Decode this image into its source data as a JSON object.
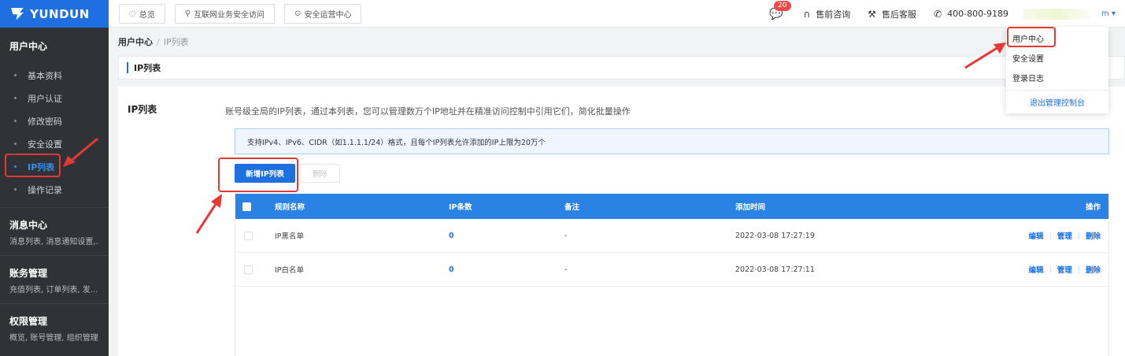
{
  "brand": {
    "name": "YUNDUN"
  },
  "topbar": {
    "buttons": [
      {
        "label": "总览",
        "icon": "dashboard-icon"
      },
      {
        "label": "互联网业务安全访问",
        "icon": "link-icon"
      },
      {
        "label": "安全运营中心",
        "icon": "shield-icon"
      }
    ],
    "message_count": "20",
    "presales": "售前咨询",
    "aftersales": "售后客服",
    "phone": "400-800-9189",
    "user_caret": "m ▾"
  },
  "sidebar": {
    "section_title": "用户中心",
    "items": [
      {
        "label": "基本资料"
      },
      {
        "label": "用户认证"
      },
      {
        "label": "修改密码"
      },
      {
        "label": "安全设置"
      },
      {
        "label": "IP列表"
      },
      {
        "label": "操作记录"
      }
    ],
    "active_index": 4,
    "groups": [
      {
        "title": "消息中心",
        "desc": "消息列表, 消息通知设置,..."
      },
      {
        "title": "账务管理",
        "desc": "充值列表, 订单列表, 发..."
      },
      {
        "title": "权限管理",
        "desc": "概览, 账号管理, 组织管理"
      }
    ]
  },
  "breadcrumb": {
    "root": "用户中心",
    "sep": "/",
    "current": "IP列表"
  },
  "page_title": "IP列表",
  "main": {
    "section_title": "IP列表",
    "description": "账号级全局的IP列表，通过本列表，您可以管理数万个IP地址并在精准访问控制中引用它们，简化批量操作",
    "notice": "支持IPv4、IPv6、CIDR（如1.1.1.1/24）格式，且每个IP列表允许添加的IP上限为20万个",
    "add_button": "新增IP列表",
    "delete_button": "删除"
  },
  "table": {
    "headers": {
      "name": "规则名称",
      "count": "IP条数",
      "remark": "备注",
      "time": "添加时间",
      "ops": "操作"
    },
    "rows": [
      {
        "name": "IP黑名单",
        "count": "0",
        "remark": "-",
        "time": "2022-03-08 17:27:19"
      },
      {
        "name": "IP白名单",
        "count": "0",
        "remark": "-",
        "time": "2022-03-08 17:27:11"
      }
    ],
    "ops": {
      "edit": "编辑",
      "manage": "管理",
      "delete": "删除"
    }
  },
  "dropdown": {
    "items": [
      "用户中心",
      "安全设置",
      "登录日志"
    ],
    "logout": "退出管理控制台"
  },
  "colors": {
    "primary": "#1e6fe0",
    "annotation": "#e53935",
    "sidebar_bg": "#2f3237"
  }
}
